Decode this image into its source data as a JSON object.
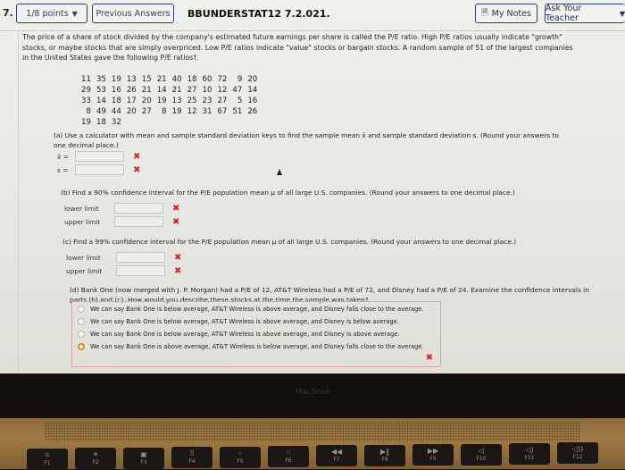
{
  "header": {
    "question_number": "7.",
    "points_label": "1/8 points",
    "previous_answers_label": "Previous Answers",
    "assignment_id": "BBUNDERSTAT12 7.2.021.",
    "my_notes_label": "My Notes",
    "ask_teacher_label": "Ask Your Teacher"
  },
  "intro": "The price of a share of stock divided by the company's estimated future earnings per share is called the P/E ratio. High P/E ratios usually indicate \"growth\" stocks, or maybe stocks that are simply overpriced. Low P/E ratios indicate \"value\" stocks or bargain stocks. A random sample of 51 of the largest companies in the United States gave the following P/E ratios†.",
  "pe_ratios": [
    [
      "11",
      "35",
      "19",
      "13",
      "15",
      "21",
      "40",
      "18",
      "60",
      "72",
      "9",
      "20"
    ],
    [
      "29",
      "53",
      "16",
      "26",
      "21",
      "14",
      "21",
      "27",
      "10",
      "12",
      "47",
      "14"
    ],
    [
      "33",
      "14",
      "18",
      "17",
      "20",
      "19",
      "13",
      "25",
      "23",
      "27",
      "5",
      "16"
    ],
    [
      "8",
      "49",
      "44",
      "20",
      "27",
      "8",
      "19",
      "12",
      "31",
      "67",
      "51",
      "26"
    ],
    [
      "19",
      "18",
      "32"
    ]
  ],
  "part_a": {
    "prompt": "(a) Use a calculator with mean and sample standard deviation keys to find the sample mean x̄ and sample standard deviation s. (Round your answers to one decimal place.)",
    "fields": [
      {
        "label": "x̄ =",
        "value": "",
        "status": "incorrect"
      },
      {
        "label": "s =",
        "value": "",
        "status": "incorrect"
      }
    ]
  },
  "part_b": {
    "prompt": "(b) Find a 90% confidence interval for the P/E population mean μ of all large U.S. companies. (Round your answers to one decimal place.)",
    "fields": [
      {
        "label": "lower limit",
        "value": "",
        "status": "incorrect"
      },
      {
        "label": "upper limit",
        "value": "",
        "status": "incorrect"
      }
    ]
  },
  "part_c": {
    "prompt": "(c) Find a 99% confidence interval for the P/E population mean μ of all large U.S. companies. (Round your answers to one decimal place.)",
    "fields": [
      {
        "label": "lower limit",
        "value": "",
        "status": "incorrect"
      },
      {
        "label": "upper limit",
        "value": "",
        "status": "incorrect"
      }
    ]
  },
  "part_d": {
    "prompt": "(d) Bank One (now merged with J. P. Morgan) had a P/E of 12, AT&T Wireless had a P/E of 72, and Disney had a P/E of 24. Examine the confidence intervals in parts (b) and (c). How would you describe these stocks at the time the sample was taken?",
    "options": [
      {
        "text": "We can say Bank One is below average, AT&T Wireless is above average, and Disney falls close to the average.",
        "selected": false
      },
      {
        "text": "We can say Bank One is below average, AT&T Wireless is above average, and Disney is below average.",
        "selected": false
      },
      {
        "text": "We can say Bank One is below average, AT&T Wireless is above average, and Disney is above average.",
        "selected": false
      },
      {
        "text": "We can say Bank One is above average, AT&T Wireless is below average, and Disney falls close to the average.",
        "selected": true
      }
    ],
    "status": "incorrect"
  },
  "marks": {
    "incorrect": "✖"
  },
  "laptop": {
    "brand": "MacBook",
    "function_keys": [
      {
        "label": "F1",
        "glyph": "☼"
      },
      {
        "label": "F2",
        "glyph": "☀"
      },
      {
        "label": "F3",
        "glyph": "▣"
      },
      {
        "label": "F4",
        "glyph": "⠿"
      },
      {
        "label": "F5",
        "glyph": "⁘"
      },
      {
        "label": "F6",
        "glyph": "⁙"
      },
      {
        "label": "F7",
        "glyph": "◀◀"
      },
      {
        "label": "F8",
        "glyph": "▶‖"
      },
      {
        "label": "F9",
        "glyph": "▶▶"
      },
      {
        "label": "F10",
        "glyph": "◁"
      },
      {
        "label": "F11",
        "glyph": "◁)"
      },
      {
        "label": "F12",
        "glyph": "◁))"
      }
    ]
  },
  "colors": {
    "accent": "#2c3e6a",
    "error": "#d9252a",
    "selected_radio": "#e38a0c"
  }
}
